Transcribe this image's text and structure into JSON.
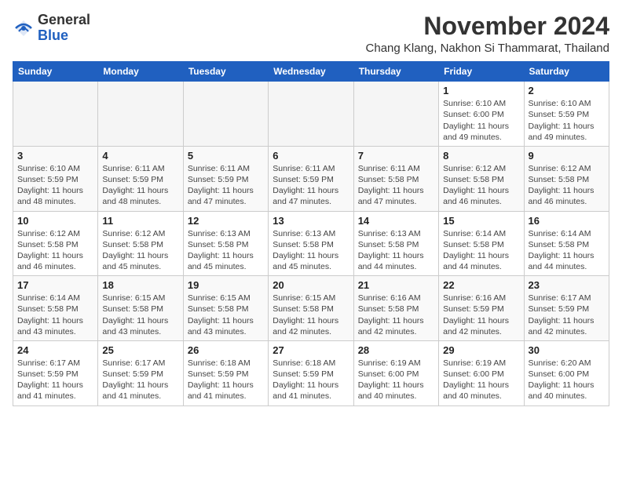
{
  "header": {
    "logo_general": "General",
    "logo_blue": "Blue",
    "month_title": "November 2024",
    "subtitle": "Chang Klang, Nakhon Si Thammarat, Thailand"
  },
  "days_of_week": [
    "Sunday",
    "Monday",
    "Tuesday",
    "Wednesday",
    "Thursday",
    "Friday",
    "Saturday"
  ],
  "weeks": [
    {
      "days": [
        {
          "num": "",
          "info": "",
          "empty": true
        },
        {
          "num": "",
          "info": "",
          "empty": true
        },
        {
          "num": "",
          "info": "",
          "empty": true
        },
        {
          "num": "",
          "info": "",
          "empty": true
        },
        {
          "num": "",
          "info": "",
          "empty": true
        },
        {
          "num": "1",
          "info": "Sunrise: 6:10 AM\nSunset: 6:00 PM\nDaylight: 11 hours\nand 49 minutes."
        },
        {
          "num": "2",
          "info": "Sunrise: 6:10 AM\nSunset: 5:59 PM\nDaylight: 11 hours\nand 49 minutes."
        }
      ]
    },
    {
      "days": [
        {
          "num": "3",
          "info": "Sunrise: 6:10 AM\nSunset: 5:59 PM\nDaylight: 11 hours\nand 48 minutes."
        },
        {
          "num": "4",
          "info": "Sunrise: 6:11 AM\nSunset: 5:59 PM\nDaylight: 11 hours\nand 48 minutes."
        },
        {
          "num": "5",
          "info": "Sunrise: 6:11 AM\nSunset: 5:59 PM\nDaylight: 11 hours\nand 47 minutes."
        },
        {
          "num": "6",
          "info": "Sunrise: 6:11 AM\nSunset: 5:59 PM\nDaylight: 11 hours\nand 47 minutes."
        },
        {
          "num": "7",
          "info": "Sunrise: 6:11 AM\nSunset: 5:58 PM\nDaylight: 11 hours\nand 47 minutes."
        },
        {
          "num": "8",
          "info": "Sunrise: 6:12 AM\nSunset: 5:58 PM\nDaylight: 11 hours\nand 46 minutes."
        },
        {
          "num": "9",
          "info": "Sunrise: 6:12 AM\nSunset: 5:58 PM\nDaylight: 11 hours\nand 46 minutes."
        }
      ]
    },
    {
      "days": [
        {
          "num": "10",
          "info": "Sunrise: 6:12 AM\nSunset: 5:58 PM\nDaylight: 11 hours\nand 46 minutes."
        },
        {
          "num": "11",
          "info": "Sunrise: 6:12 AM\nSunset: 5:58 PM\nDaylight: 11 hours\nand 45 minutes."
        },
        {
          "num": "12",
          "info": "Sunrise: 6:13 AM\nSunset: 5:58 PM\nDaylight: 11 hours\nand 45 minutes."
        },
        {
          "num": "13",
          "info": "Sunrise: 6:13 AM\nSunset: 5:58 PM\nDaylight: 11 hours\nand 45 minutes."
        },
        {
          "num": "14",
          "info": "Sunrise: 6:13 AM\nSunset: 5:58 PM\nDaylight: 11 hours\nand 44 minutes."
        },
        {
          "num": "15",
          "info": "Sunrise: 6:14 AM\nSunset: 5:58 PM\nDaylight: 11 hours\nand 44 minutes."
        },
        {
          "num": "16",
          "info": "Sunrise: 6:14 AM\nSunset: 5:58 PM\nDaylight: 11 hours\nand 44 minutes."
        }
      ]
    },
    {
      "days": [
        {
          "num": "17",
          "info": "Sunrise: 6:14 AM\nSunset: 5:58 PM\nDaylight: 11 hours\nand 43 minutes."
        },
        {
          "num": "18",
          "info": "Sunrise: 6:15 AM\nSunset: 5:58 PM\nDaylight: 11 hours\nand 43 minutes."
        },
        {
          "num": "19",
          "info": "Sunrise: 6:15 AM\nSunset: 5:58 PM\nDaylight: 11 hours\nand 43 minutes."
        },
        {
          "num": "20",
          "info": "Sunrise: 6:15 AM\nSunset: 5:58 PM\nDaylight: 11 hours\nand 42 minutes."
        },
        {
          "num": "21",
          "info": "Sunrise: 6:16 AM\nSunset: 5:58 PM\nDaylight: 11 hours\nand 42 minutes."
        },
        {
          "num": "22",
          "info": "Sunrise: 6:16 AM\nSunset: 5:59 PM\nDaylight: 11 hours\nand 42 minutes."
        },
        {
          "num": "23",
          "info": "Sunrise: 6:17 AM\nSunset: 5:59 PM\nDaylight: 11 hours\nand 42 minutes."
        }
      ]
    },
    {
      "days": [
        {
          "num": "24",
          "info": "Sunrise: 6:17 AM\nSunset: 5:59 PM\nDaylight: 11 hours\nand 41 minutes."
        },
        {
          "num": "25",
          "info": "Sunrise: 6:17 AM\nSunset: 5:59 PM\nDaylight: 11 hours\nand 41 minutes."
        },
        {
          "num": "26",
          "info": "Sunrise: 6:18 AM\nSunset: 5:59 PM\nDaylight: 11 hours\nand 41 minutes."
        },
        {
          "num": "27",
          "info": "Sunrise: 6:18 AM\nSunset: 5:59 PM\nDaylight: 11 hours\nand 41 minutes."
        },
        {
          "num": "28",
          "info": "Sunrise: 6:19 AM\nSunset: 6:00 PM\nDaylight: 11 hours\nand 40 minutes."
        },
        {
          "num": "29",
          "info": "Sunrise: 6:19 AM\nSunset: 6:00 PM\nDaylight: 11 hours\nand 40 minutes."
        },
        {
          "num": "30",
          "info": "Sunrise: 6:20 AM\nSunset: 6:00 PM\nDaylight: 11 hours\nand 40 minutes."
        }
      ]
    }
  ]
}
